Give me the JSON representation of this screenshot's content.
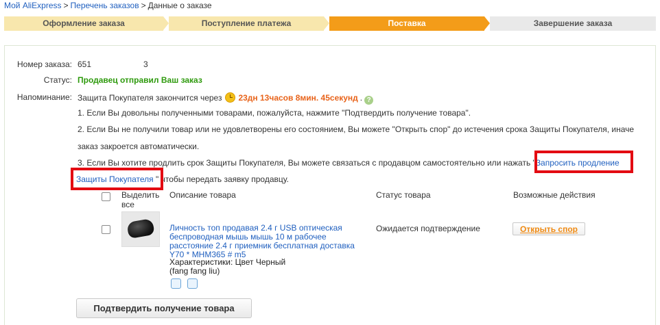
{
  "breadcrumb": {
    "items": [
      "Мой AliExpress",
      "Перечень заказов",
      "Данные о заказе"
    ],
    "sep": ">"
  },
  "steps": [
    "Оформление заказа",
    "Поступление платежа",
    "Поставка",
    "Завершение заказа"
  ],
  "order": {
    "number_label": "Номер заказа:",
    "number_value": "651",
    "number_suffix": "3",
    "status_label": "Статус:",
    "status_value": "Продавец отправил Ваш заказ",
    "reminder_label": "Напоминание:",
    "reminder_text": "Защита Покупателя закончится через",
    "countdown": "23дн 13часов 8мин. 45секунд",
    "countdown_after": ".",
    "help": "?"
  },
  "notes": {
    "n1": "1. Если Вы довольны полученными товарами, пожалуйста, нажмите \"Подтвердить получение товара\".",
    "n2a": "2. Если Вы не получили товар или не удовлетворены его состоянием, Вы можете \"Открыть спор\" до истечения срока Защиты Покупателя, иначе",
    "n2b": "заказ закроется автоматически.",
    "n3a": "3. Если Вы хотите продлить срок Защиты Покупателя, Вы можете связаться с продавцом самостоятельно или нажать \"",
    "n3_link1": "Запросить продление",
    "n3_link2": "Защиты Покупателя",
    "n3b": "\" чтобы передать заявку продавцу."
  },
  "table": {
    "select_all_1": "Выделить",
    "select_all_2": "все",
    "col_desc": "Описание товара",
    "col_status": "Статус товара",
    "col_actions": "Возможные действия"
  },
  "item": {
    "title_lines": [
      "Личность топ продавая 2.4 г USB оптическая",
      "беспроводная мышь мышь 10 м рабочее",
      "расстояние 2.4 г приемник бесплатная доставка",
      "Y70 * MHM365 # m5"
    ],
    "attrs": "Характеристики: Цвет Черный",
    "seller": "(fang fang liu)",
    "status": "Ожидается подтверждение",
    "dispute_button": "Открыть спор"
  },
  "confirm_button": "Подтвердить получение товара",
  "colors": {
    "step_done": "#f8e7ad",
    "step_active": "#f39c19",
    "step_todo": "#e9e9e9",
    "link": "#1f5fbf",
    "status_green": "#2e9a0d",
    "countdown_orange": "#e8631a",
    "highlight_red": "#e30b12"
  },
  "icons": [
    "clock-icon",
    "help-icon",
    "alarm-clock-icon",
    "refresh-icon",
    "mouse-product-image"
  ]
}
